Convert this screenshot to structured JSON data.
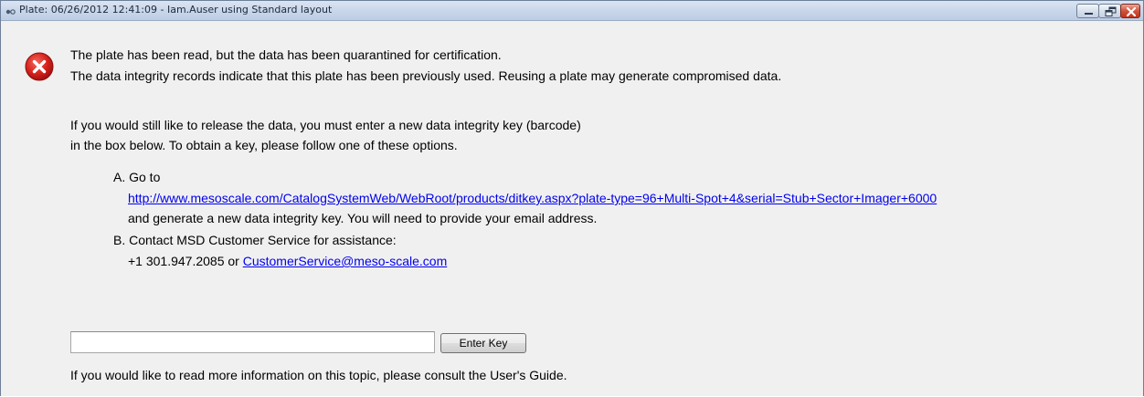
{
  "window": {
    "title": "Plate: 06/26/2012 12:41:09 - Iam.Auser using Standard layout"
  },
  "message": {
    "line1": "The plate has been read, but the data has been quarantined for certification.",
    "line2": "The data integrity records indicate that this plate has been previously used. Reusing a plate may generate compromised data."
  },
  "instructions": {
    "line1": "If you would still like to release the data, you must enter a new data integrity key (barcode)",
    "line2": "in the box below. To obtain a key, please follow one of these options."
  },
  "option_a": {
    "label": "A. Go to",
    "url": "http://www.mesoscale.com/CatalogSystemWeb/WebRoot/products/ditkey.aspx?plate-type=96+Multi-Spot+4&serial=Stub+Sector+Imager+6000",
    "text": "and generate a new data integrity key. You will need to provide your email address."
  },
  "option_b": {
    "label": "B. Contact MSD Customer Service for assistance:",
    "phone_prefix": "+1 301.947.2085 or ",
    "email": "CustomerService@meso-scale.com"
  },
  "key_entry": {
    "value": "",
    "button_label": "Enter Key"
  },
  "footer": {
    "text": "If you would like to read more information on this topic, please consult the User's Guide."
  },
  "icons": {
    "error": "error-circle-x",
    "window_controls": [
      "minimize",
      "maximize",
      "close"
    ]
  },
  "colors": {
    "error_red": "#d8231e",
    "link_blue": "#0000ee",
    "window_bg": "#f0f0f0"
  }
}
